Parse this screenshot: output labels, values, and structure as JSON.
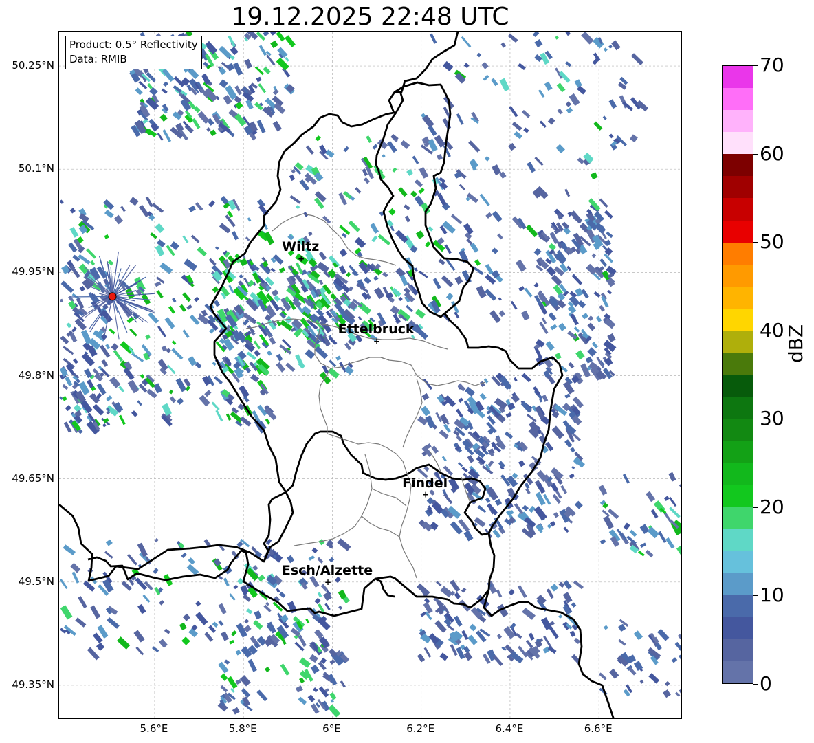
{
  "title": "19.12.2025 22:48 UTC",
  "info": {
    "product": "Product: 0.5° Reflectivity",
    "data": "Data: RMIB"
  },
  "axes": {
    "lat_ticks": [
      "50.25°N",
      "50.1°N",
      "49.95°N",
      "49.8°N",
      "49.65°N",
      "49.5°N",
      "49.35°N"
    ],
    "lon_ticks": [
      "5.6°E",
      "5.8°E",
      "6°E",
      "6.2°E",
      "6.4°E",
      "6.6°E"
    ]
  },
  "cities": [
    {
      "name": "Wiltz",
      "lon": 5.93,
      "lat": 49.97
    },
    {
      "name": "Ettelbruck",
      "lon": 6.1,
      "lat": 49.85
    },
    {
      "name": "Findel",
      "lon": 6.21,
      "lat": 49.627
    },
    {
      "name": "Esch/Alzette",
      "lon": 5.99,
      "lat": 49.5
    }
  ],
  "radar_site": {
    "lon": 5.505,
    "lat": 49.915,
    "color": "#e8190f"
  },
  "colorbar": {
    "unit": "dBZ",
    "min": 0,
    "max": 70,
    "tick_labels": [
      "0",
      "10",
      "20",
      "30",
      "40",
      "50",
      "60",
      "70"
    ],
    "colors": [
      "#6473a9",
      "#5665a0",
      "#44579e",
      "#4a6aaa",
      "#5b9bc9",
      "#66c1dc",
      "#5fd8c6",
      "#3fd66c",
      "#12c81e",
      "#12b81c",
      "#13a116",
      "#128912",
      "#0d7710",
      "#075b0b",
      "#4a7a0b",
      "#afaf0b",
      "#ffd600",
      "#ffb400",
      "#ff9a00",
      "#ff7d00",
      "#e80000",
      "#c80000",
      "#a00000",
      "#7d0000",
      "#ffe0fb",
      "#ffb2fb",
      "#ff6ef8",
      "#ea36ea"
    ]
  }
}
